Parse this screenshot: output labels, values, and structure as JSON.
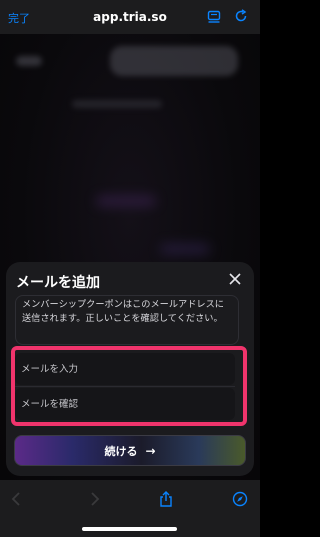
{
  "browser": {
    "done_label": "完了",
    "url": "app.tria.so"
  },
  "dialog": {
    "title": "メールを追加",
    "notice": "メンバーシップクーポンはこのメールアドレスに送信されます。正しいことを確認してください。",
    "email_placeholder": "メールを入力",
    "confirm_placeholder": "メールを確認",
    "continue_label": "続ける",
    "continue_arrow": "→"
  },
  "colors": {
    "accent": "#0a84ff",
    "highlight": "#f0346c",
    "sheet": "#1b1b1e"
  },
  "icons": [
    "reader-icon",
    "reload-icon",
    "close-icon",
    "back-icon",
    "forward-icon",
    "share-icon",
    "compass-icon"
  ]
}
